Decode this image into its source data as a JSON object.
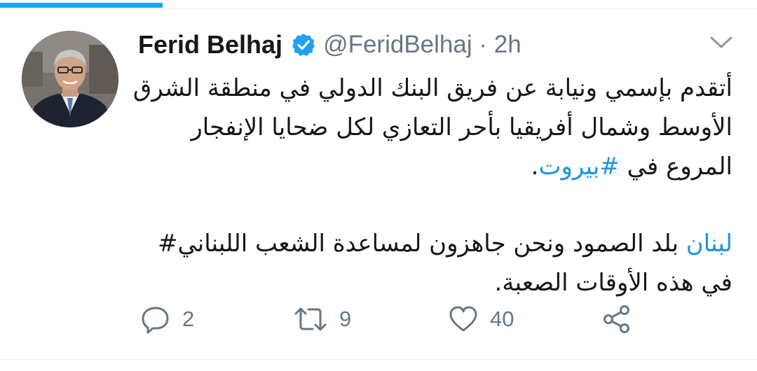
{
  "loading_bar": {
    "color": "#1da1f2",
    "progress": 0.215
  },
  "tweet": {
    "author_name": "Ferid Belhaj",
    "handle": "@FeridBelhaj",
    "separator": " · ",
    "time": "2h",
    "verified": true,
    "paragraph1": {
      "text": "أتقدم بإسمي ونيابة عن فريق البنك الدولي في منطقة الشرق الأوسط وشمال أفريقيا بأحر التعازي لكل ضحايا الإنفجار المروع في ",
      "hashtag": "#بيروت",
      "suffix": "."
    },
    "paragraph2": {
      "hashtag": "لبنان",
      "text": " بلد الصمود ونحن جاهزون لمساعدة الشعب اللبناني# في هذه الأوقات الصعبة."
    },
    "actions": {
      "reply": {
        "icon": "reply-icon",
        "count": "2"
      },
      "retweet": {
        "icon": "retweet-icon",
        "count": "9"
      },
      "like": {
        "icon": "heart-icon",
        "count": "40"
      },
      "share": {
        "icon": "share-icon"
      }
    }
  },
  "colors": {
    "accent": "#1da1f2",
    "link": "#1b95e0",
    "muted": "#657786",
    "text": "#14171a"
  }
}
